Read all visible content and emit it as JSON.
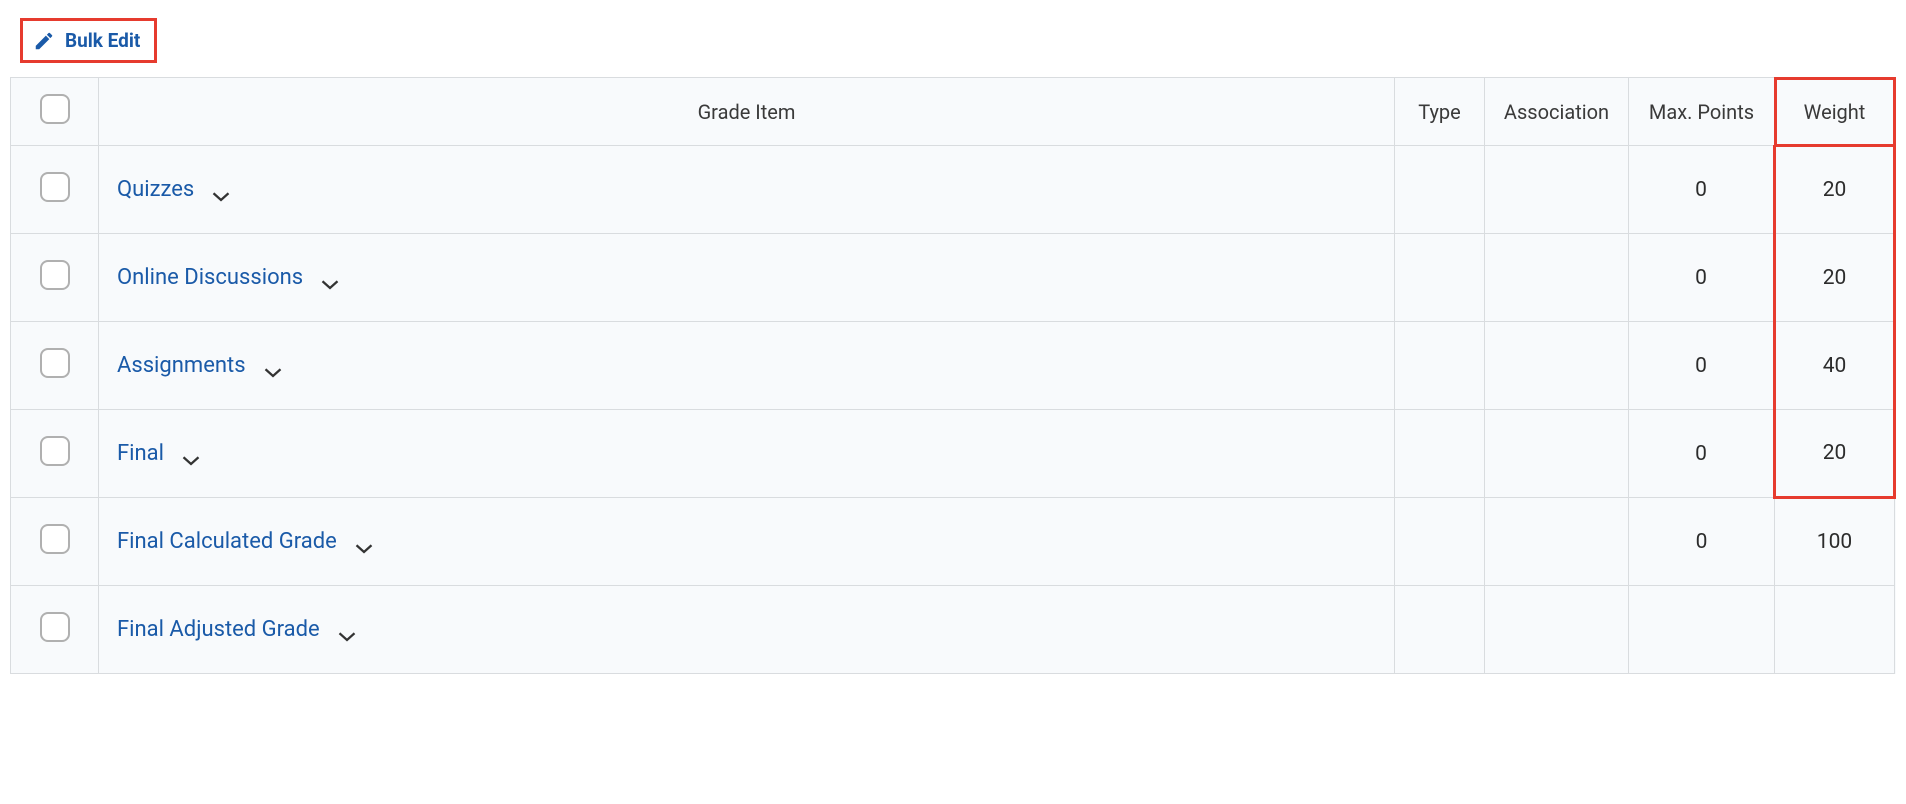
{
  "toolbar": {
    "bulk_edit_label": "Bulk Edit"
  },
  "columns": {
    "grade_item": "Grade Item",
    "type": "Type",
    "association": "Association",
    "max_points": "Max. Points",
    "weight": "Weight"
  },
  "rows": [
    {
      "name": "Quizzes",
      "type": "",
      "association": "",
      "max_points": "0",
      "weight": "20",
      "highlight_weight": true
    },
    {
      "name": "Online Discussions",
      "type": "",
      "association": "",
      "max_points": "0",
      "weight": "20",
      "highlight_weight": true
    },
    {
      "name": "Assignments",
      "type": "",
      "association": "",
      "max_points": "0",
      "weight": "40",
      "highlight_weight": true
    },
    {
      "name": "Final",
      "type": "",
      "association": "",
      "max_points": "0",
      "weight": "20",
      "highlight_weight": true
    },
    {
      "name": "Final Calculated Grade",
      "type": "",
      "association": "",
      "max_points": "0",
      "weight": "100",
      "highlight_weight": false
    },
    {
      "name": "Final Adjusted Grade",
      "type": "",
      "association": "",
      "max_points": "",
      "weight": "",
      "highlight_weight": false
    }
  ]
}
